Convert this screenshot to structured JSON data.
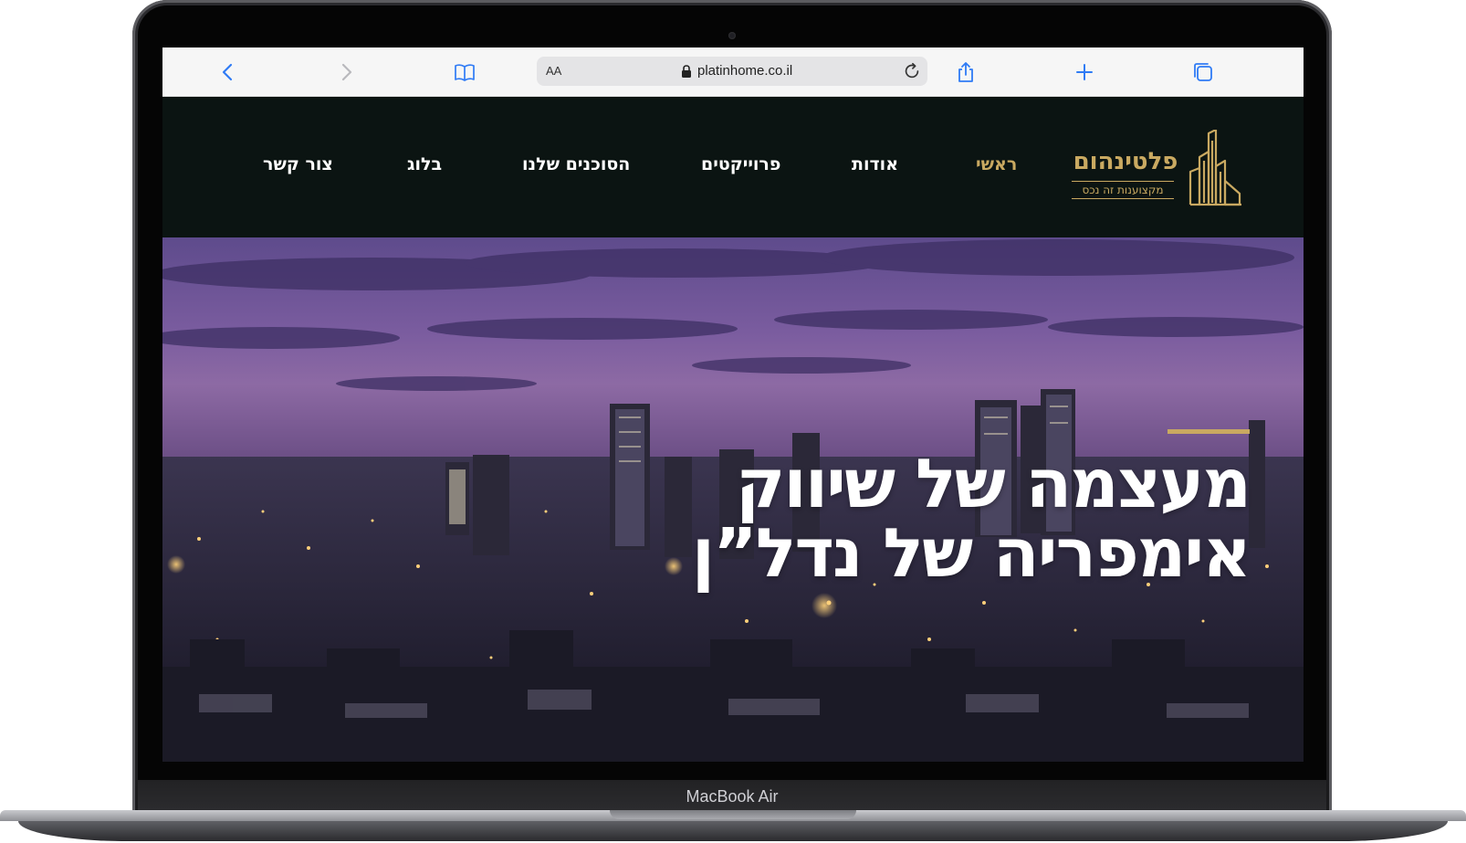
{
  "device": {
    "label": "MacBook Air"
  },
  "browser": {
    "reader_label": "AA",
    "url": "platinhome.co.il",
    "icons": [
      "chevron-left-icon",
      "chevron-right-icon",
      "book-icon",
      "lock-icon",
      "reload-icon",
      "share-icon",
      "plus-icon",
      "tabs-icon"
    ]
  },
  "site": {
    "logo": {
      "name": "פלטינהום",
      "tagline": "מקצוענות זה נכס"
    },
    "nav": [
      {
        "label": "ראשי",
        "active": true
      },
      {
        "label": "אודות",
        "active": false
      },
      {
        "label": "פרוייקטים",
        "active": false
      },
      {
        "label": "הסוכנים שלנו",
        "active": false
      },
      {
        "label": "בלוג",
        "active": false
      },
      {
        "label": "צור קשר",
        "active": false
      }
    ],
    "hero": {
      "line1": "מעצמה של שיווק",
      "line2": "אימפריה של נדל”ן"
    },
    "colors": {
      "accent": "#c9a961",
      "header_bg": "#0b1412",
      "text": "#ffffff"
    }
  }
}
